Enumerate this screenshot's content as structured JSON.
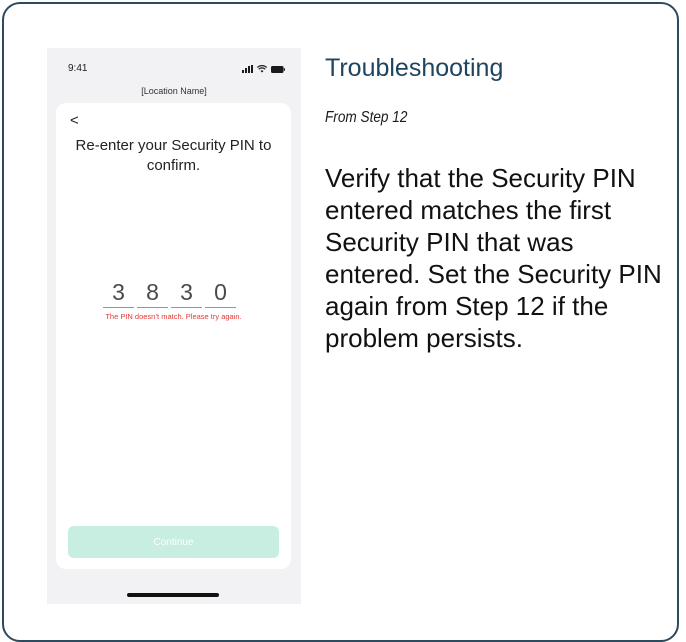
{
  "phone": {
    "status_time": "9:41",
    "location_name": "[Location Name]",
    "back_label": "<",
    "title": "Re-enter your Security PIN to confirm.",
    "pin_digits": [
      "3",
      "8",
      "3",
      "0"
    ],
    "error_message": "The PIN doesn’t match. Please try again.",
    "continue_label": "Continue"
  },
  "troubleshooting": {
    "title": "Troubleshooting",
    "step_ref": "From Step 12",
    "body": "Verify that the Security PIN entered matches the first Security PIN that was entered. Set the Security PIN again from Step 12 if the problem persists."
  },
  "colors": {
    "title_blue": "#1e4560",
    "error_red": "#e53935",
    "continue_disabled": "#c7eee0",
    "card_border": "#2e4a5e"
  }
}
